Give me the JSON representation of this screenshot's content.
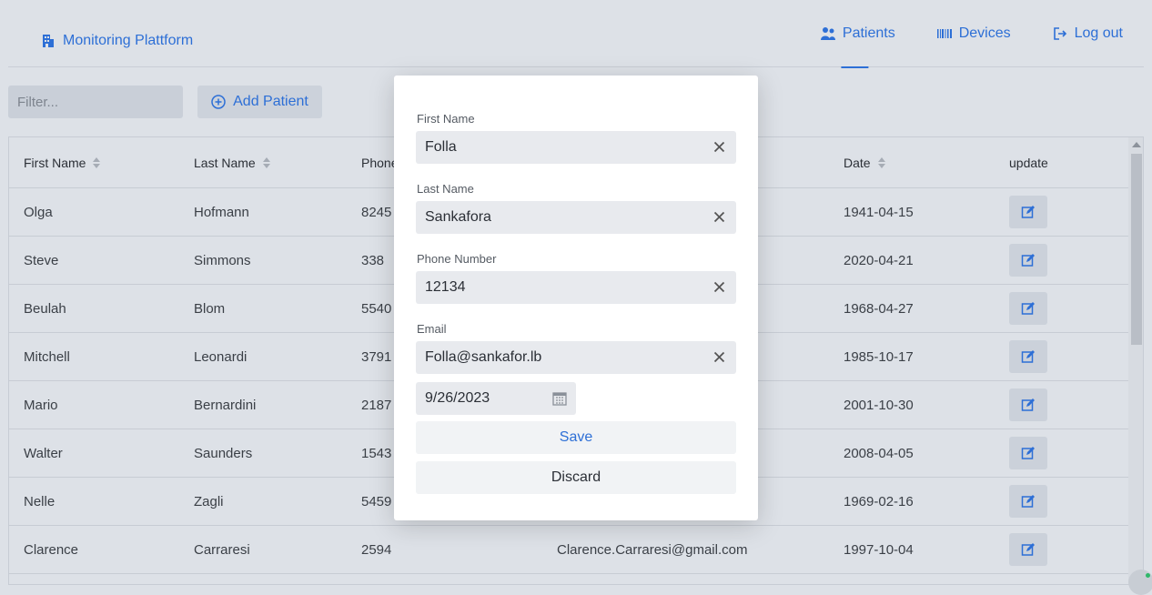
{
  "header": {
    "brand": "Monitoring Plattform",
    "nav": [
      {
        "label": "Patients",
        "active": true
      },
      {
        "label": "Devices",
        "active": false
      },
      {
        "label": "Log out",
        "active": false
      }
    ]
  },
  "toolbar": {
    "filter_placeholder": "Filter...",
    "add_label": "Add Patient"
  },
  "table": {
    "columns": [
      "First Name",
      "Last Name",
      "Phone",
      "Date",
      "update"
    ],
    "rows": [
      {
        "first": "Olga",
        "last": "Hofmann",
        "phone": "8245",
        "email": "",
        "date": "1941-04-15"
      },
      {
        "first": "Steve",
        "last": "Simmons",
        "phone": "338",
        "email": "",
        "date": "2020-04-21"
      },
      {
        "first": "Beulah",
        "last": "Blom",
        "phone": "5540",
        "email": "",
        "date": "1968-04-27"
      },
      {
        "first": "Mitchell",
        "last": "Leonardi",
        "phone": "3791",
        "email": "",
        "date": "1985-10-17"
      },
      {
        "first": "Mario",
        "last": "Bernardini",
        "phone": "2187",
        "email": "",
        "date": "2001-10-30"
      },
      {
        "first": "Walter",
        "last": "Saunders",
        "phone": "1543",
        "email": "",
        "date": "2008-04-05"
      },
      {
        "first": "Nelle",
        "last": "Zagli",
        "phone": "5459",
        "email": "",
        "date": "1969-02-16"
      },
      {
        "first": "Clarence",
        "last": "Carraresi",
        "phone": "2594",
        "email": "Clarence.Carraresi@gmail.com",
        "date": "1997-10-04"
      }
    ]
  },
  "modal": {
    "first_name_label": "First Name",
    "first_name_value": "Folla",
    "last_name_label": "Last Name",
    "last_name_value": "Sankafora",
    "phone_label": "Phone Number",
    "phone_value": "12134",
    "email_label": "Email",
    "email_value": "Folla@sankafor.lb",
    "date_value": "9/26/2023",
    "save_label": "Save",
    "discard_label": "Discard"
  },
  "colors": {
    "accent": "#2d6fd6",
    "background": "#dde1e7",
    "modal_bg": "#ffffff"
  }
}
